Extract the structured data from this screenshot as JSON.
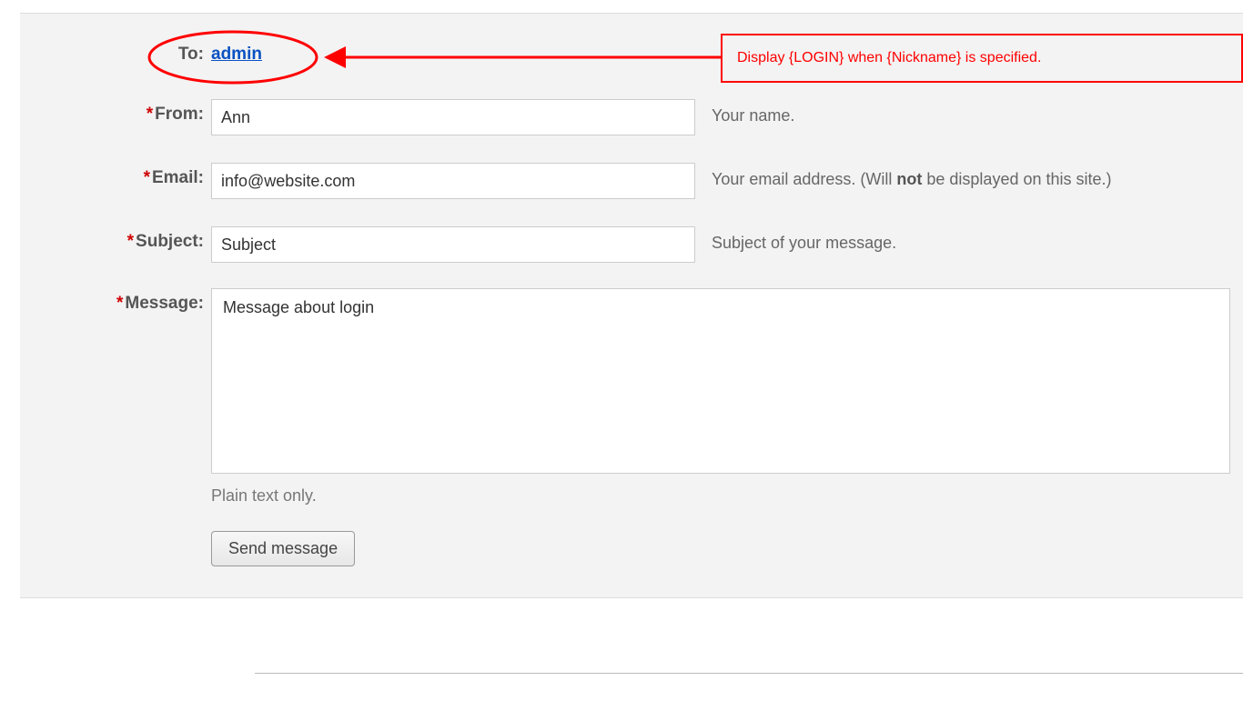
{
  "form": {
    "to": {
      "label": "To:",
      "value": "admin"
    },
    "from": {
      "label": "From:",
      "value": "Ann",
      "hint": "Your name."
    },
    "email": {
      "label": "Email:",
      "value": "info@website.com",
      "hint_prefix": "Your email address. (Will ",
      "hint_bold": "not",
      "hint_suffix": " be displayed on this site.)"
    },
    "subject": {
      "label": "Subject:",
      "value": "Subject",
      "hint": "Subject of your message."
    },
    "message": {
      "label": "Message:",
      "value": "Message about login",
      "note": "Plain text only."
    },
    "submit": "Send message",
    "required_mark": "*"
  },
  "callout": {
    "text": "Display {LOGIN} when {Nickname} is specified."
  }
}
